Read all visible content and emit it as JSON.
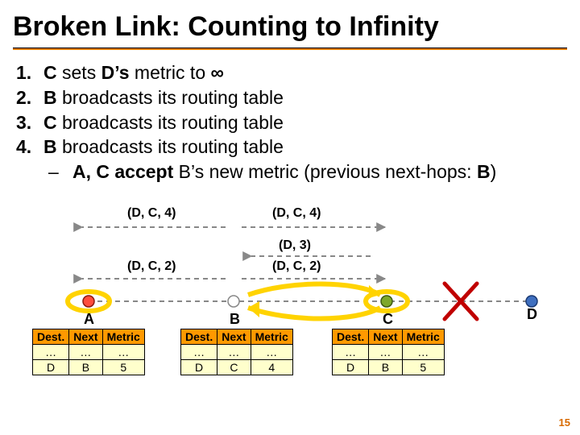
{
  "title": "Broken Link: Counting to Infinity",
  "steps": [
    {
      "n": "1.",
      "html": "<b>C</b> sets <b>D’s</b> metric to <b>∞</b>"
    },
    {
      "n": "2.",
      "html": "<b>B</b> broadcasts its routing table"
    },
    {
      "n": "3.",
      "html": "<b>C</b> broadcasts its routing table"
    },
    {
      "n": "4.",
      "html": "<b>B</b> broadcasts its routing table"
    }
  ],
  "sub": {
    "dash": "–",
    "html": "<b>A, C accept</b> B’s new metric (previous next-hops: <b>B</b>)"
  },
  "labels": {
    "dc4a": "(D, C, 4)",
    "dc4b": "(D, C, 4)",
    "d3": "(D, 3)",
    "dc2a": "(D, C, 2)",
    "dc2b": "(D, C, 2)"
  },
  "nodes": {
    "A": "A",
    "B": "B",
    "C": "C",
    "D": "D"
  },
  "tables": {
    "headers": [
      "Dest.",
      "Next",
      "Metric"
    ],
    "A": [
      [
        "…",
        "…",
        "…"
      ],
      [
        "D",
        "B",
        "5"
      ]
    ],
    "B": [
      [
        "…",
        "…",
        "…"
      ],
      [
        "D",
        "C",
        "4"
      ]
    ],
    "C": [
      [
        "…",
        "…",
        "…"
      ],
      [
        "D",
        "B",
        "5"
      ]
    ]
  },
  "page": "15"
}
